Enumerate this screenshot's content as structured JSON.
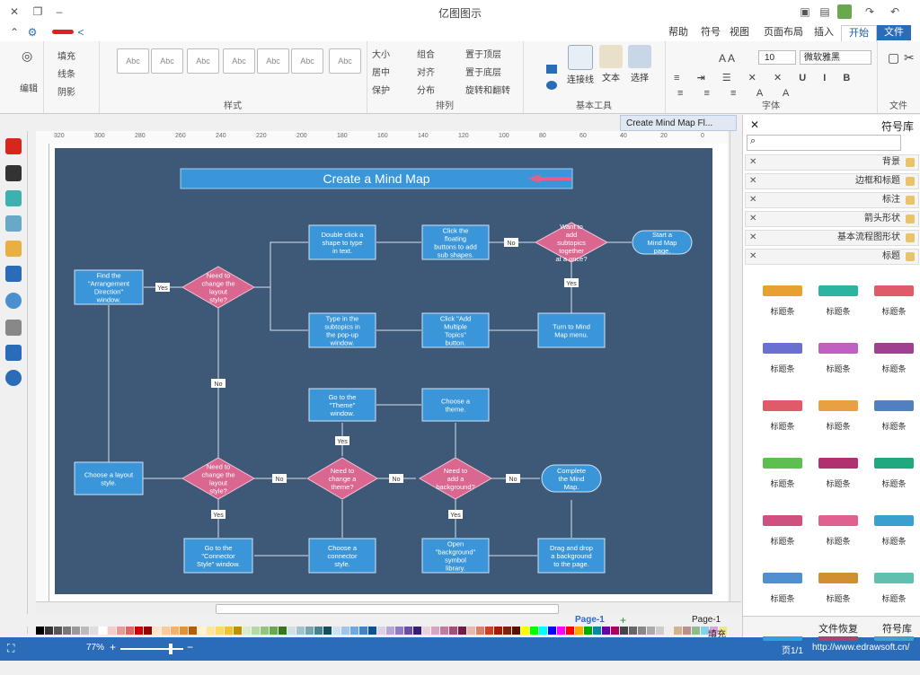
{
  "window": {
    "title": "亿图图示"
  },
  "menu": {
    "tabs": [
      "文件",
      "开始",
      "插入",
      "页面布局",
      "视图",
      "符号",
      "帮助"
    ]
  },
  "ribbon": {
    "groups": {
      "file": "文件",
      "font": "字体",
      "basic_tools": "基本工具",
      "arrange": "排列",
      "style": "样式",
      "edit": "编辑"
    },
    "font_name": "微软雅黑",
    "font_size": "10",
    "tools": {
      "select": "选择",
      "text": "文本",
      "connector": "连接线"
    },
    "arrange_items": [
      "置于顶层",
      "置于底层",
      "旋转和翻转",
      "组合",
      "对齐",
      "分布",
      "大小",
      "居中",
      "保护"
    ],
    "style_fill": "填充",
    "style_line": "线条",
    "style_shadow": "阴影",
    "abc_label": "Abc",
    "edit_label": "编辑"
  },
  "document": {
    "tab_label": "Create Mind Map Fl..."
  },
  "ruler": {
    "ticks": [
      "0",
      "20",
      "40",
      "60",
      "80",
      "100",
      "120",
      "140",
      "160",
      "180",
      "200",
      "220",
      "240",
      "260",
      "280",
      "300",
      "320"
    ]
  },
  "diagram": {
    "title": "Create a Mind Map",
    "nodes": {
      "start": "Start a Mind Map page.",
      "q_subtopics": "Want to add subtopics together at a once?",
      "floating": "Click the floating buttons to add sub shapes.",
      "double_click": "Double click a shape to type in text.",
      "q_layout1": "Need to change the layout style?",
      "find_arrangement": "Find the \"Arrangement Direction\" window.",
      "turn_to": "Turn to Mind Map menu.",
      "add_multiple": "Click \"Add Multiple Topics\" button.",
      "type_subtopics": "Type in the subtopics in the pop-up window.",
      "choose_theme": "Choose a theme.",
      "goto_theme": "Go to the \"Theme\" window.",
      "q_background": "Need to add a background?",
      "q_theme": "Need to change a theme?",
      "q_layout2": "Need to change the layout style?",
      "choose_layout": "Choose a layout style.",
      "complete": "Complete the Mind Map.",
      "drag_bg": "Drag and drop a background to the page.",
      "open_bg": "Open \"background\" symbol library.",
      "choose_connector": "Choose a connector style.",
      "goto_connector": "Go to the \"Connector Style\" window."
    },
    "labels": {
      "yes": "Yes",
      "no": "No"
    }
  },
  "pages": {
    "current": "Page-1",
    "tab": "Page-1"
  },
  "status": {
    "url": "http://www.edrawsoft.cn/",
    "page_info": "页1/1",
    "zoom": "77%"
  },
  "fill_label": "填充",
  "right_panel": {
    "title": "符号库",
    "sections": [
      "背景",
      "边框和标题",
      "标注",
      "箭头形状",
      "基本流程图形状",
      "标题"
    ],
    "shape_label": "标题条",
    "tabs": [
      "符号库",
      "文件恢复"
    ]
  },
  "colors": {
    "accent": "#2b6cb8",
    "diagram_bg": "#3e5878",
    "node_blue": "#3a96d8",
    "node_pink": "#d9678f"
  }
}
